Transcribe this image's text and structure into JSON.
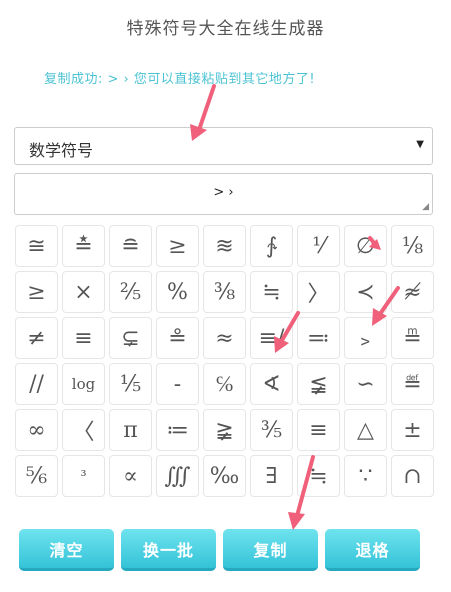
{
  "header": {
    "title": "特殊符号大全在线生成器"
  },
  "status": {
    "message": "复制成功: > ›  您可以直接粘贴到其它地方了!"
  },
  "category_select": {
    "selected": "数学符号"
  },
  "output": {
    "value": "> ›"
  },
  "symbols": [
    "≅",
    "≛",
    "≘",
    "≥",
    "≋",
    "∱",
    "⅟",
    "∅",
    "⅛",
    "≥",
    "×",
    "⅖",
    "%",
    "⅜",
    "≒",
    "〉",
    "≺",
    "≉",
    "≠",
    "≡",
    "⊊",
    "≗",
    "≈",
    "≡/",
    "≕",
    "﹥",
    "≞",
    "//",
    "log",
    "⅕",
    "-",
    "℅",
    "∢",
    "≨",
    "∽",
    "≝",
    "∞",
    "〈",
    "π",
    "≔",
    "≩",
    "⅗",
    "≡",
    "△",
    "±",
    "⅚",
    "³",
    "∝",
    "∭",
    "‰",
    "∃",
    "≒",
    "∵",
    "∩"
  ],
  "buttons": {
    "clear": "清空",
    "next_batch": "换一批",
    "copy": "复制",
    "backspace": "退格"
  },
  "colors": {
    "accent": "#34c3d8",
    "status_text": "#4cc3d3",
    "annotation_arrow": "#f0607a"
  }
}
